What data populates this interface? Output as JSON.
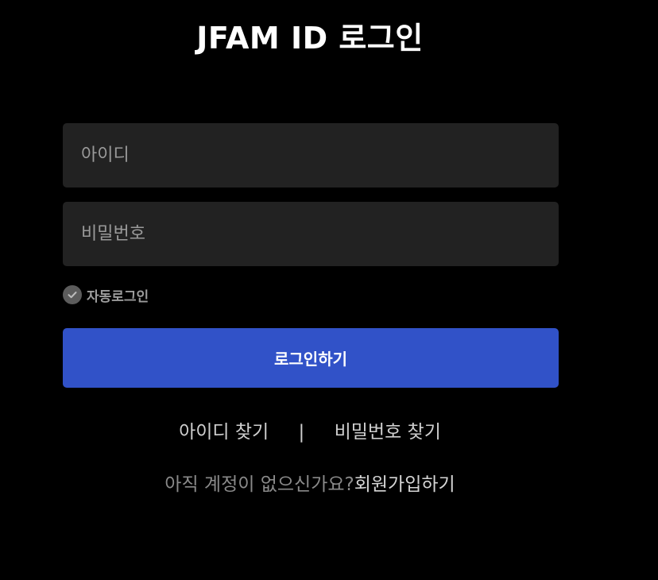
{
  "header": {
    "title": "JFAM ID 로그인"
  },
  "form": {
    "id_placeholder": "아이디",
    "id_value": "",
    "password_placeholder": "비밀번호",
    "password_value": "",
    "auto_login_label": "자동로그인",
    "auto_login_icon": "check-circle-icon",
    "submit_label": "로그인하기"
  },
  "links": {
    "find_id": "아이디 찾기",
    "separator": "|",
    "find_password": "비밀번호 찾기",
    "signup_prompt": "아직 계정이 없으신가요?",
    "signup_link": "회원가입하기"
  },
  "colors": {
    "background": "#000000",
    "input_background": "#222222",
    "button_primary": "#3152c8",
    "checkbox": "#5c5c5c"
  }
}
